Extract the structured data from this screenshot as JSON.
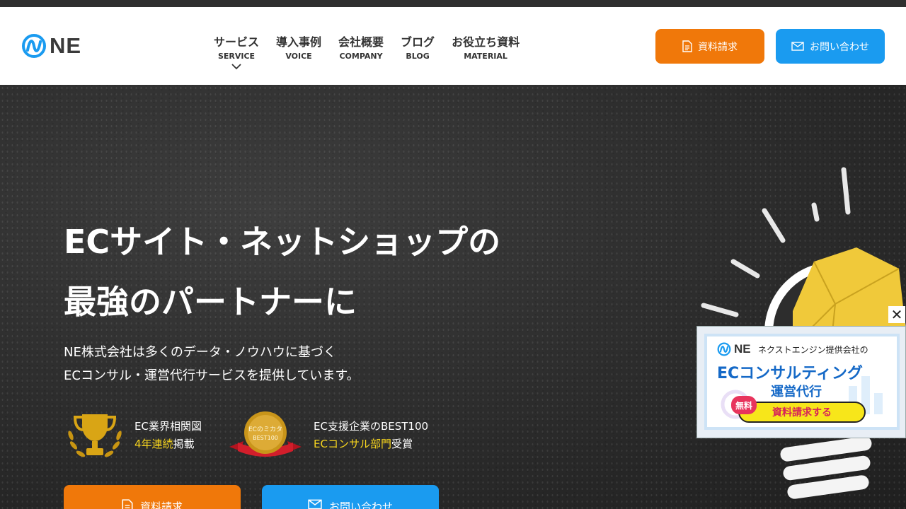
{
  "header": {
    "logo_text": "NE",
    "nav": [
      {
        "ja": "サービス",
        "en": "SERVICE",
        "has_dropdown": true
      },
      {
        "ja": "導入事例",
        "en": "VOICE"
      },
      {
        "ja": "会社概要",
        "en": "COMPANY"
      },
      {
        "ja": "ブログ",
        "en": "BLOG"
      },
      {
        "ja": "お役立ち資料",
        "en": "MATERIAL"
      }
    ],
    "request_button": "資料請求",
    "contact_button": "お問い合わせ"
  },
  "hero": {
    "headline_line1": "ECサイト・ネットショップの",
    "headline_line2": "最強のパートナーに",
    "sub_line1": "NE株式会社は多くのデータ・ノウハウに基づく",
    "sub_line2": "ECコンサル・運営代行サービスを提供しています。",
    "award1": {
      "line1": "EC業界相関図",
      "highlight": "4年連続",
      "rest": "掲載"
    },
    "award2": {
      "line1": "EC支援企業のBEST100",
      "highlight": "ECコンサル部門",
      "rest": "受賞",
      "medal_line1": "ECのミカタ",
      "medal_line2": "BEST100"
    },
    "cta_request": "資料請求",
    "cta_contact": "お問い合わせ"
  },
  "popup": {
    "logo_text": "NE",
    "provider": "ネクストエンジン提供会社の",
    "title1": "ECコンサルティング",
    "title2": "運営代行",
    "free_badge": "無料",
    "cta": "資料請求する",
    "close": "✕"
  },
  "colors": {
    "accent_orange": "#f0780a",
    "accent_blue": "#1a9bf0",
    "highlight_yellow": "#f7d51e"
  }
}
